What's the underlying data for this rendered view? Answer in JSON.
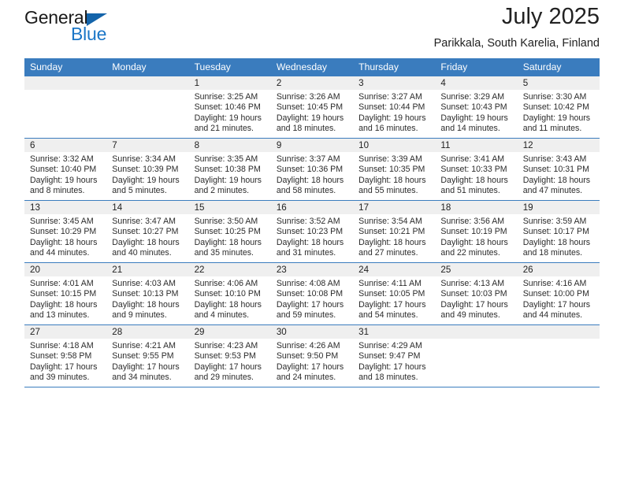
{
  "brand": {
    "name_part1": "General",
    "name_part2": "Blue",
    "accent_color": "#1b76c7"
  },
  "header": {
    "title": "July 2025",
    "subtitle": "Parikkala, South Karelia, Finland"
  },
  "calendar": {
    "header_bg": "#3a7cbe",
    "daynum_bg": "#efefef",
    "weekday_names": [
      "Sunday",
      "Monday",
      "Tuesday",
      "Wednesday",
      "Thursday",
      "Friday",
      "Saturday"
    ],
    "weeks": [
      [
        {
          "day": "",
          "sunrise": "",
          "sunset": "",
          "daylight_line1": "",
          "daylight_line2": ""
        },
        {
          "day": "",
          "sunrise": "",
          "sunset": "",
          "daylight_line1": "",
          "daylight_line2": ""
        },
        {
          "day": "1",
          "sunrise": "Sunrise: 3:25 AM",
          "sunset": "Sunset: 10:46 PM",
          "daylight_line1": "Daylight: 19 hours",
          "daylight_line2": "and 21 minutes."
        },
        {
          "day": "2",
          "sunrise": "Sunrise: 3:26 AM",
          "sunset": "Sunset: 10:45 PM",
          "daylight_line1": "Daylight: 19 hours",
          "daylight_line2": "and 18 minutes."
        },
        {
          "day": "3",
          "sunrise": "Sunrise: 3:27 AM",
          "sunset": "Sunset: 10:44 PM",
          "daylight_line1": "Daylight: 19 hours",
          "daylight_line2": "and 16 minutes."
        },
        {
          "day": "4",
          "sunrise": "Sunrise: 3:29 AM",
          "sunset": "Sunset: 10:43 PM",
          "daylight_line1": "Daylight: 19 hours",
          "daylight_line2": "and 14 minutes."
        },
        {
          "day": "5",
          "sunrise": "Sunrise: 3:30 AM",
          "sunset": "Sunset: 10:42 PM",
          "daylight_line1": "Daylight: 19 hours",
          "daylight_line2": "and 11 minutes."
        }
      ],
      [
        {
          "day": "6",
          "sunrise": "Sunrise: 3:32 AM",
          "sunset": "Sunset: 10:40 PM",
          "daylight_line1": "Daylight: 19 hours",
          "daylight_line2": "and 8 minutes."
        },
        {
          "day": "7",
          "sunrise": "Sunrise: 3:34 AM",
          "sunset": "Sunset: 10:39 PM",
          "daylight_line1": "Daylight: 19 hours",
          "daylight_line2": "and 5 minutes."
        },
        {
          "day": "8",
          "sunrise": "Sunrise: 3:35 AM",
          "sunset": "Sunset: 10:38 PM",
          "daylight_line1": "Daylight: 19 hours",
          "daylight_line2": "and 2 minutes."
        },
        {
          "day": "9",
          "sunrise": "Sunrise: 3:37 AM",
          "sunset": "Sunset: 10:36 PM",
          "daylight_line1": "Daylight: 18 hours",
          "daylight_line2": "and 58 minutes."
        },
        {
          "day": "10",
          "sunrise": "Sunrise: 3:39 AM",
          "sunset": "Sunset: 10:35 PM",
          "daylight_line1": "Daylight: 18 hours",
          "daylight_line2": "and 55 minutes."
        },
        {
          "day": "11",
          "sunrise": "Sunrise: 3:41 AM",
          "sunset": "Sunset: 10:33 PM",
          "daylight_line1": "Daylight: 18 hours",
          "daylight_line2": "and 51 minutes."
        },
        {
          "day": "12",
          "sunrise": "Sunrise: 3:43 AM",
          "sunset": "Sunset: 10:31 PM",
          "daylight_line1": "Daylight: 18 hours",
          "daylight_line2": "and 47 minutes."
        }
      ],
      [
        {
          "day": "13",
          "sunrise": "Sunrise: 3:45 AM",
          "sunset": "Sunset: 10:29 PM",
          "daylight_line1": "Daylight: 18 hours",
          "daylight_line2": "and 44 minutes."
        },
        {
          "day": "14",
          "sunrise": "Sunrise: 3:47 AM",
          "sunset": "Sunset: 10:27 PM",
          "daylight_line1": "Daylight: 18 hours",
          "daylight_line2": "and 40 minutes."
        },
        {
          "day": "15",
          "sunrise": "Sunrise: 3:50 AM",
          "sunset": "Sunset: 10:25 PM",
          "daylight_line1": "Daylight: 18 hours",
          "daylight_line2": "and 35 minutes."
        },
        {
          "day": "16",
          "sunrise": "Sunrise: 3:52 AM",
          "sunset": "Sunset: 10:23 PM",
          "daylight_line1": "Daylight: 18 hours",
          "daylight_line2": "and 31 minutes."
        },
        {
          "day": "17",
          "sunrise": "Sunrise: 3:54 AM",
          "sunset": "Sunset: 10:21 PM",
          "daylight_line1": "Daylight: 18 hours",
          "daylight_line2": "and 27 minutes."
        },
        {
          "day": "18",
          "sunrise": "Sunrise: 3:56 AM",
          "sunset": "Sunset: 10:19 PM",
          "daylight_line1": "Daylight: 18 hours",
          "daylight_line2": "and 22 minutes."
        },
        {
          "day": "19",
          "sunrise": "Sunrise: 3:59 AM",
          "sunset": "Sunset: 10:17 PM",
          "daylight_line1": "Daylight: 18 hours",
          "daylight_line2": "and 18 minutes."
        }
      ],
      [
        {
          "day": "20",
          "sunrise": "Sunrise: 4:01 AM",
          "sunset": "Sunset: 10:15 PM",
          "daylight_line1": "Daylight: 18 hours",
          "daylight_line2": "and 13 minutes."
        },
        {
          "day": "21",
          "sunrise": "Sunrise: 4:03 AM",
          "sunset": "Sunset: 10:13 PM",
          "daylight_line1": "Daylight: 18 hours",
          "daylight_line2": "and 9 minutes."
        },
        {
          "day": "22",
          "sunrise": "Sunrise: 4:06 AM",
          "sunset": "Sunset: 10:10 PM",
          "daylight_line1": "Daylight: 18 hours",
          "daylight_line2": "and 4 minutes."
        },
        {
          "day": "23",
          "sunrise": "Sunrise: 4:08 AM",
          "sunset": "Sunset: 10:08 PM",
          "daylight_line1": "Daylight: 17 hours",
          "daylight_line2": "and 59 minutes."
        },
        {
          "day": "24",
          "sunrise": "Sunrise: 4:11 AM",
          "sunset": "Sunset: 10:05 PM",
          "daylight_line1": "Daylight: 17 hours",
          "daylight_line2": "and 54 minutes."
        },
        {
          "day": "25",
          "sunrise": "Sunrise: 4:13 AM",
          "sunset": "Sunset: 10:03 PM",
          "daylight_line1": "Daylight: 17 hours",
          "daylight_line2": "and 49 minutes."
        },
        {
          "day": "26",
          "sunrise": "Sunrise: 4:16 AM",
          "sunset": "Sunset: 10:00 PM",
          "daylight_line1": "Daylight: 17 hours",
          "daylight_line2": "and 44 minutes."
        }
      ],
      [
        {
          "day": "27",
          "sunrise": "Sunrise: 4:18 AM",
          "sunset": "Sunset: 9:58 PM",
          "daylight_line1": "Daylight: 17 hours",
          "daylight_line2": "and 39 minutes."
        },
        {
          "day": "28",
          "sunrise": "Sunrise: 4:21 AM",
          "sunset": "Sunset: 9:55 PM",
          "daylight_line1": "Daylight: 17 hours",
          "daylight_line2": "and 34 minutes."
        },
        {
          "day": "29",
          "sunrise": "Sunrise: 4:23 AM",
          "sunset": "Sunset: 9:53 PM",
          "daylight_line1": "Daylight: 17 hours",
          "daylight_line2": "and 29 minutes."
        },
        {
          "day": "30",
          "sunrise": "Sunrise: 4:26 AM",
          "sunset": "Sunset: 9:50 PM",
          "daylight_line1": "Daylight: 17 hours",
          "daylight_line2": "and 24 minutes."
        },
        {
          "day": "31",
          "sunrise": "Sunrise: 4:29 AM",
          "sunset": "Sunset: 9:47 PM",
          "daylight_line1": "Daylight: 17 hours",
          "daylight_line2": "and 18 minutes."
        },
        {
          "day": "",
          "sunrise": "",
          "sunset": "",
          "daylight_line1": "",
          "daylight_line2": ""
        },
        {
          "day": "",
          "sunrise": "",
          "sunset": "",
          "daylight_line1": "",
          "daylight_line2": ""
        }
      ]
    ]
  }
}
